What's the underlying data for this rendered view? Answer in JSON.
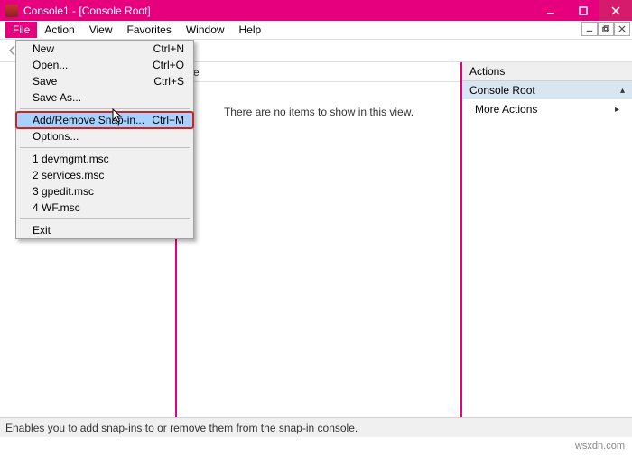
{
  "title": "Console1 - [Console Root]",
  "menu": {
    "file": "File",
    "action": "Action",
    "view": "View",
    "favorites": "Favorites",
    "window": "Window",
    "help": "Help"
  },
  "fileMenu": {
    "new": {
      "label": "New",
      "shortcut": "Ctrl+N"
    },
    "open": {
      "label": "Open...",
      "shortcut": "Ctrl+O"
    },
    "save": {
      "label": "Save",
      "shortcut": "Ctrl+S"
    },
    "saveAs": {
      "label": "Save As..."
    },
    "addRemove": {
      "label": "Add/Remove Snap-in...",
      "shortcut": "Ctrl+M"
    },
    "options": {
      "label": "Options..."
    },
    "recent": {
      "1": "1 devmgmt.msc",
      "2": "2 services.msc",
      "3": "3 gpedit.msc",
      "4": "4 WF.msc"
    },
    "exit": {
      "label": "Exit"
    }
  },
  "middle": {
    "headerCol": "me",
    "empty": "There are no items to show in this view."
  },
  "right": {
    "header": "Actions",
    "section": "Console Root",
    "moreActions": "More Actions"
  },
  "status": "Enables you to add snap-ins to or remove them from the snap-in console.",
  "watermark": "wsxdn.com"
}
